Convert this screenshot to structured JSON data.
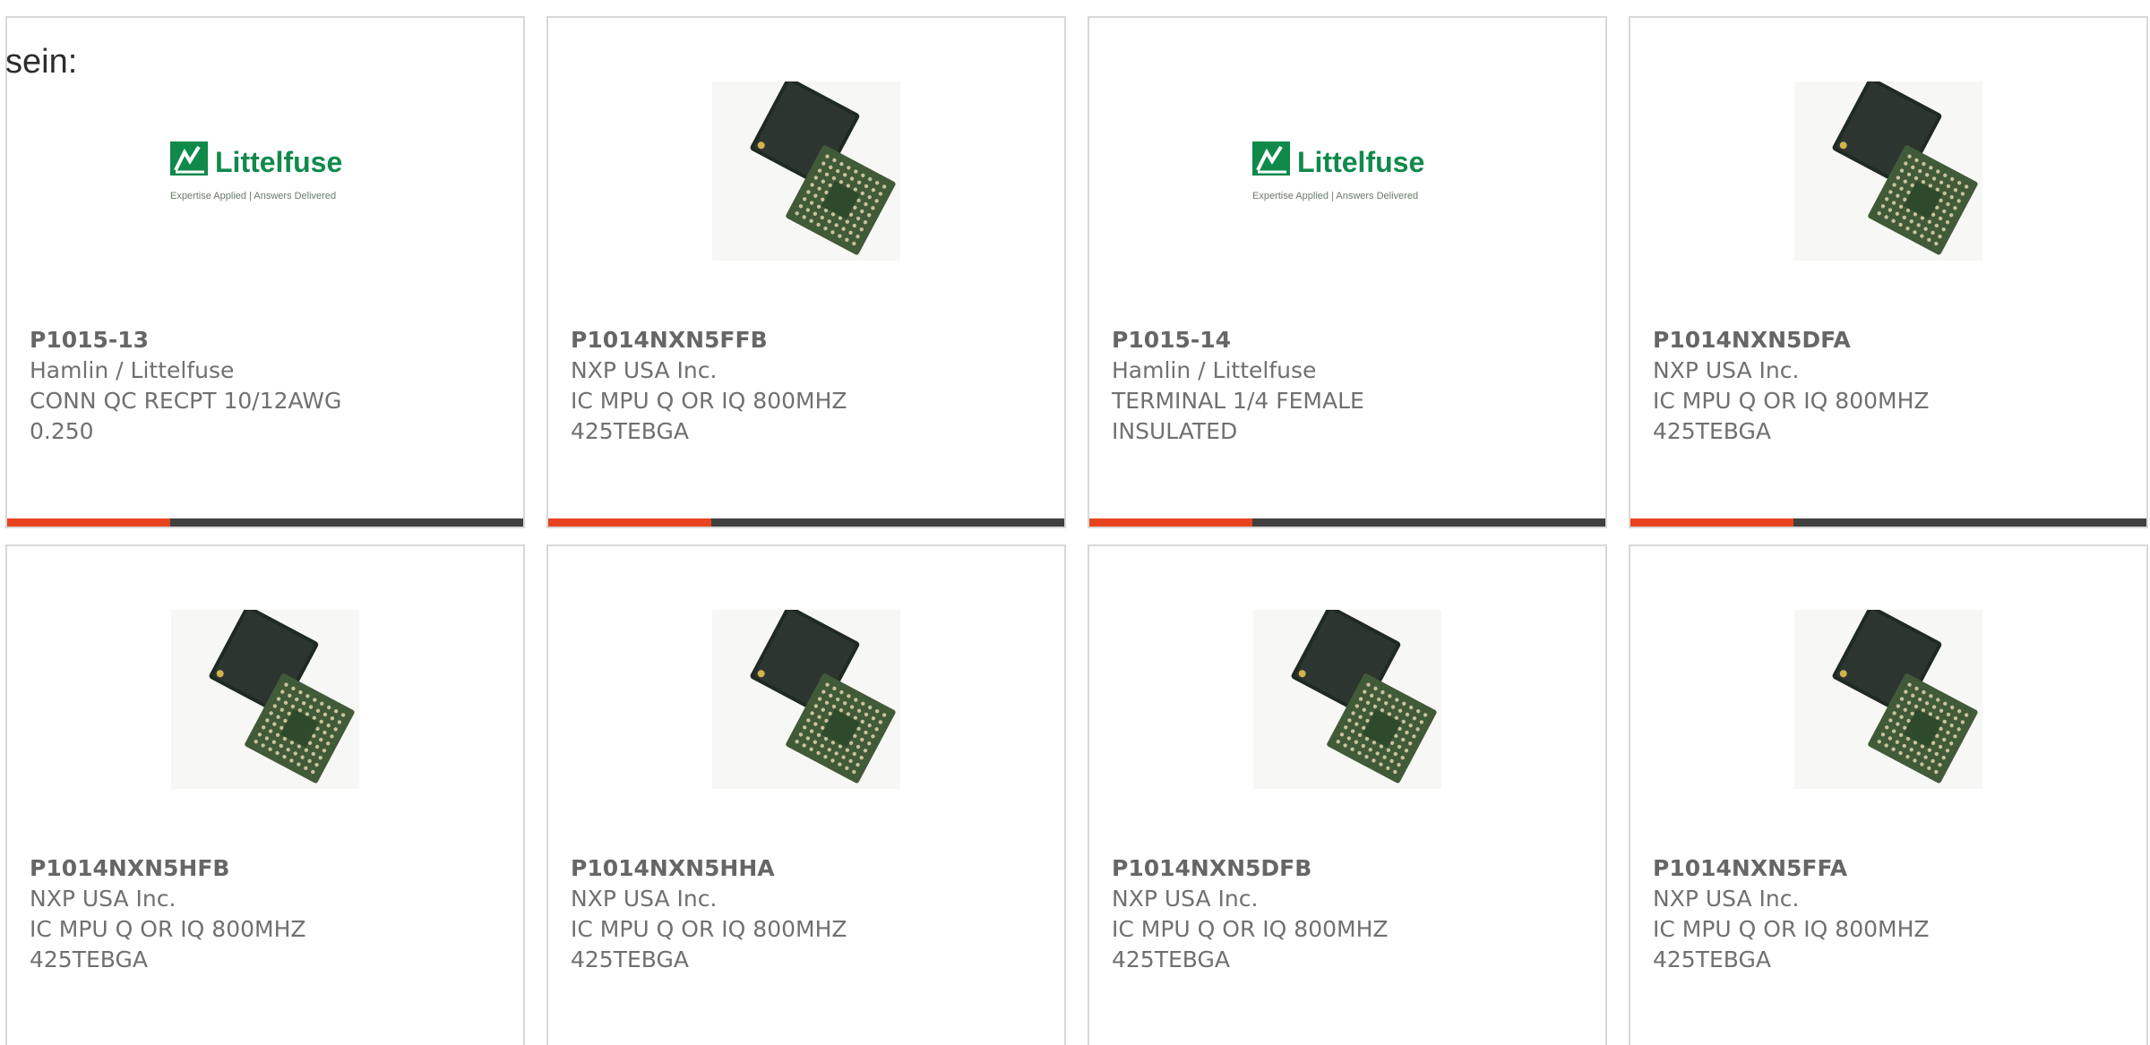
{
  "intro_text": "sein:",
  "brand_colors": {
    "accent_red": "#e8441f",
    "accent_dark": "#404040",
    "littelfuse_green": "#0f8a4b"
  },
  "logo": {
    "brand": "Littelfuse",
    "tagline": "Expertise Applied | Answers Delivered"
  },
  "cards": [
    {
      "part_number": "P1015-13",
      "manufacturer": "Hamlin / Littelfuse",
      "description": "CONN QC RECPT 10/12AWG 0.250",
      "image_type": "littelfuse-logo",
      "selected": true
    },
    {
      "part_number": "P1014NXN5FFB",
      "manufacturer": "NXP USA Inc.",
      "description": "IC MPU Q OR IQ 800MHZ 425TEBGA",
      "image_type": "bga-chip",
      "selected": true
    },
    {
      "part_number": "P1015-14",
      "manufacturer": "Hamlin / Littelfuse",
      "description": "TERMINAL 1/4 FEMALE INSULATED",
      "image_type": "littelfuse-logo",
      "selected": true
    },
    {
      "part_number": "P1014NXN5DFA",
      "manufacturer": "NXP USA Inc.",
      "description": "IC MPU Q OR IQ 800MHZ 425TEBGA",
      "image_type": "bga-chip",
      "selected": true
    },
    {
      "part_number": "P1014NXN5HFB",
      "manufacturer": "NXP USA Inc.",
      "description": "IC MPU Q OR IQ 800MHZ 425TEBGA",
      "image_type": "bga-chip",
      "selected": false
    },
    {
      "part_number": "P1014NXN5HHA",
      "manufacturer": "NXP USA Inc.",
      "description": "IC MPU Q OR IQ 800MHZ 425TEBGA",
      "image_type": "bga-chip",
      "selected": false
    },
    {
      "part_number": "P1014NXN5DFB",
      "manufacturer": "NXP USA Inc.",
      "description": "IC MPU Q OR IQ 800MHZ 425TEBGA",
      "image_type": "bga-chip",
      "selected": false
    },
    {
      "part_number": "P1014NXN5FFA",
      "manufacturer": "NXP USA Inc.",
      "description": "IC MPU Q OR IQ 800MHZ 425TEBGA",
      "image_type": "bga-chip",
      "selected": false
    }
  ]
}
